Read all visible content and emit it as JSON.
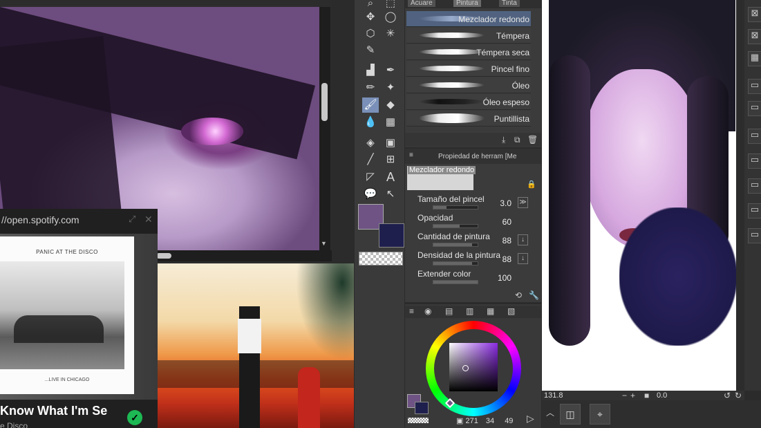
{
  "spotify": {
    "url": "//open.spotify.com",
    "album_header": "PANIC AT THE DISCO",
    "album_footer": "...LIVE IN CHICAGO",
    "song_title": "Know What I'm Se",
    "artist": "e Disco",
    "liked": "✓"
  },
  "brush_panel": {
    "tabs": [
      "Acuare",
      "Pintura",
      "Tinta"
    ],
    "brushes": [
      {
        "name": "Mezclador redondo",
        "selected": true
      },
      {
        "name": "Témpera",
        "selected": false
      },
      {
        "name": "Témpera seca",
        "selected": false
      },
      {
        "name": "Pincel fino",
        "selected": false
      },
      {
        "name": "Óleo",
        "selected": false
      },
      {
        "name": "Óleo espeso",
        "selected": false
      },
      {
        "name": "Puntillista",
        "selected": false
      }
    ]
  },
  "tool_property": {
    "header": "Propiedad de herram [Me",
    "preset_name": "Mezclador redondo",
    "rows": [
      {
        "label": "Tamaño del pincel",
        "value": "3.0",
        "fill": 0.3
      },
      {
        "label": "Opacidad",
        "value": "60",
        "fill": 0.6
      },
      {
        "label": "Cantidad de pintura",
        "value": "88",
        "fill": 0.88
      },
      {
        "label": "Densidad de la pintura",
        "value": "88",
        "fill": 0.88
      },
      {
        "label": "Extender color",
        "value": "100",
        "fill": 1.0
      }
    ]
  },
  "colors": {
    "main": "#6e5384",
    "sub": "#1f1f4e"
  },
  "color_info": {
    "h": "271",
    "s": "34",
    "v": "49"
  },
  "canvas_status": {
    "zoom": "131.8",
    "angle": "0.0"
  }
}
